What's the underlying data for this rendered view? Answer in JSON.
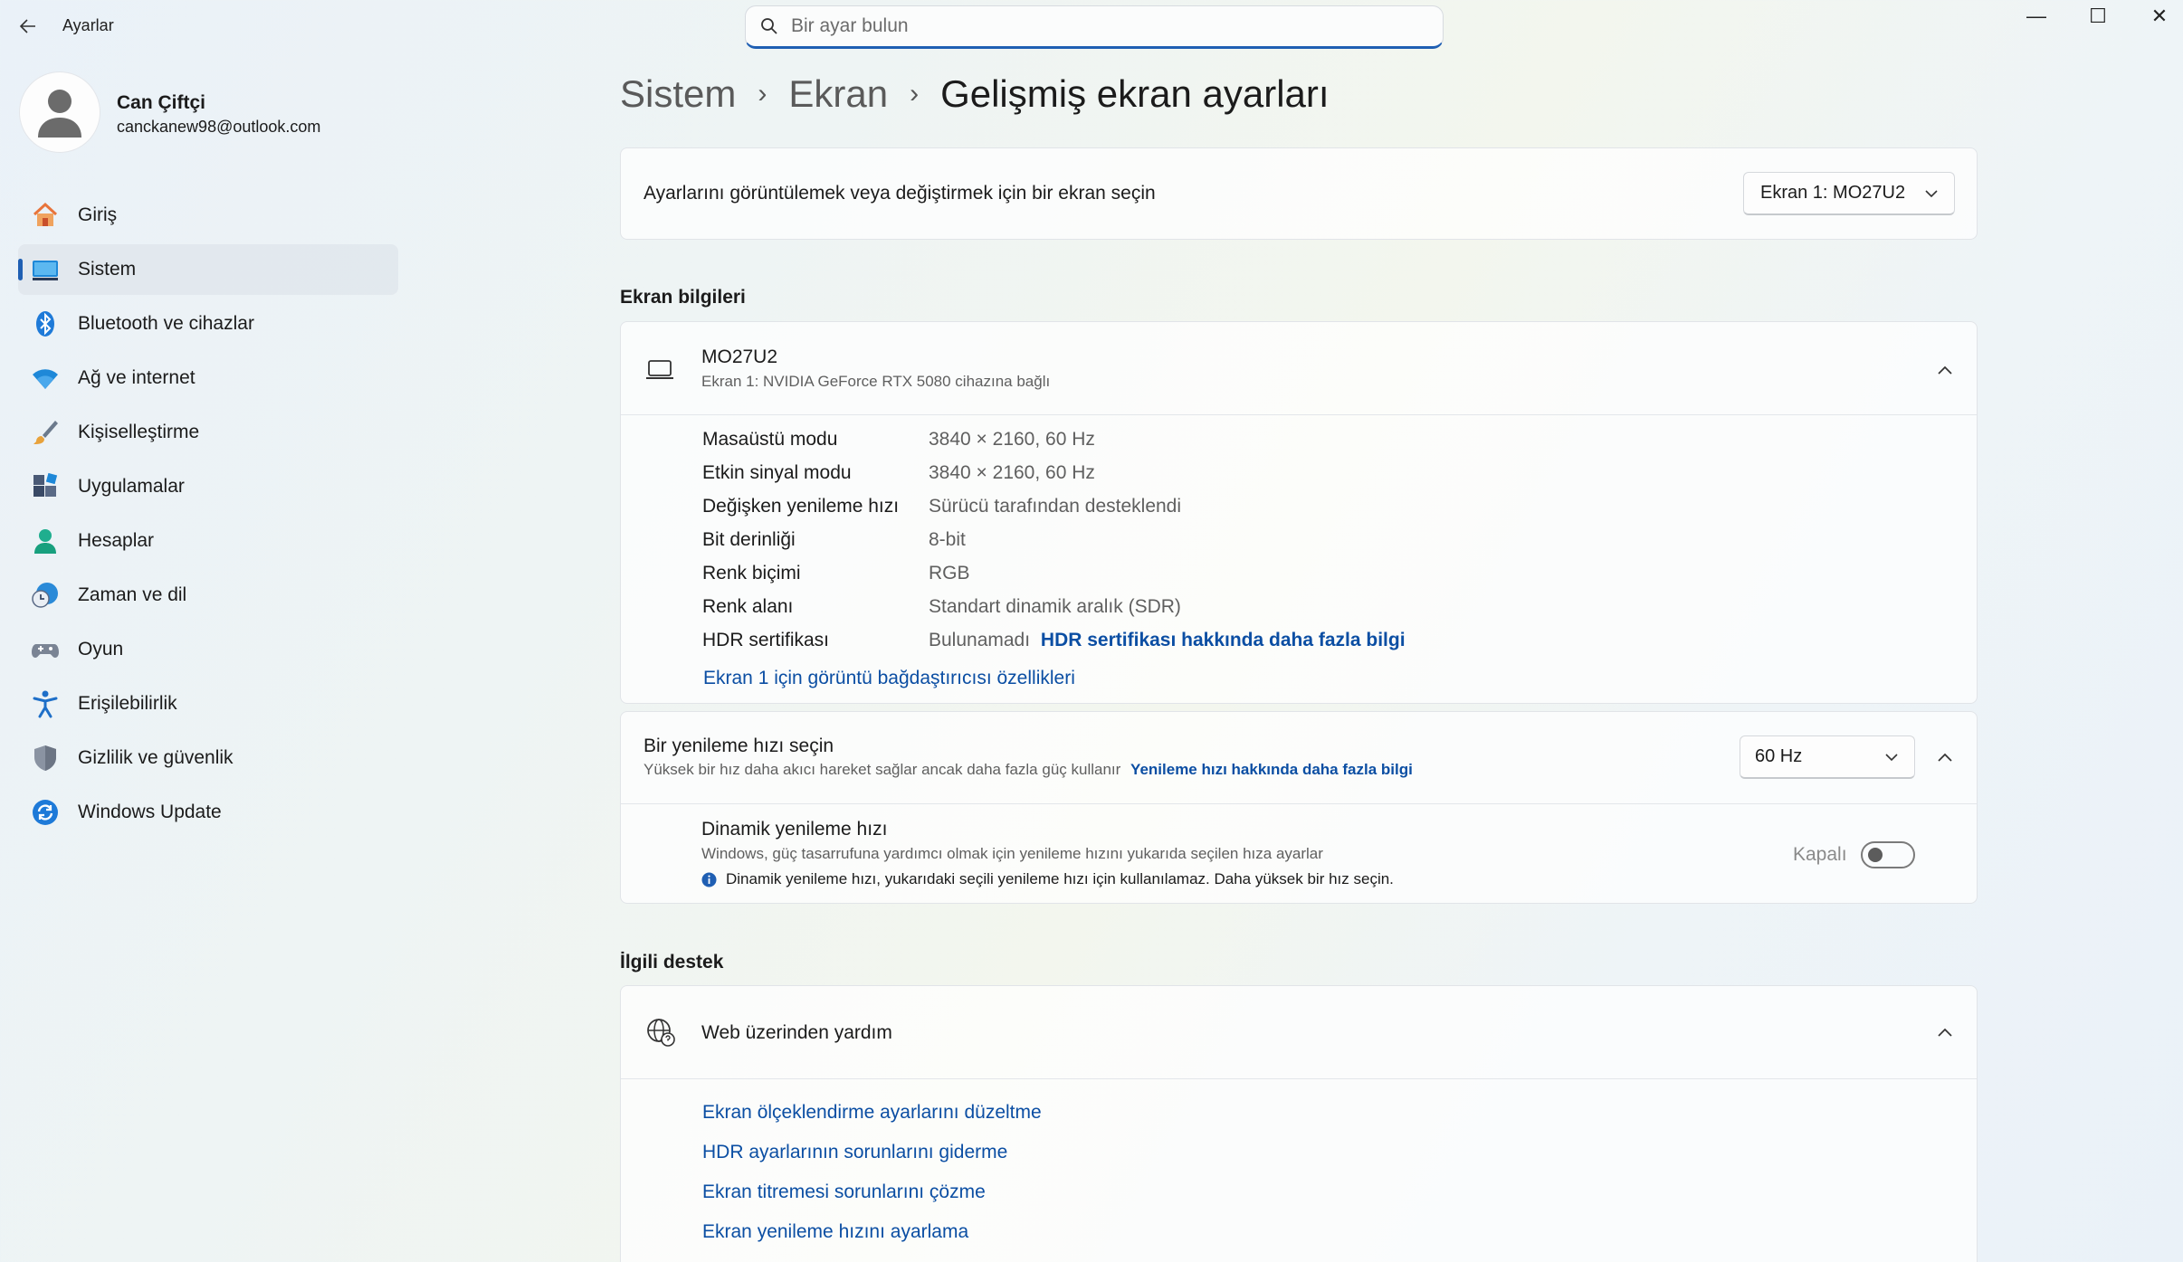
{
  "app": {
    "title": "Ayarlar",
    "back_icon": "back-arrow-icon"
  },
  "search": {
    "placeholder": "Bir ayar bulun"
  },
  "window_controls": {
    "minimize": "—",
    "maximize": "☐",
    "close": "✕"
  },
  "user": {
    "name": "Can Çiftçi",
    "email": "canckanew98@outlook.com"
  },
  "sidebar": {
    "items": [
      {
        "label": "Giriş",
        "icon": "home-icon",
        "active": false
      },
      {
        "label": "Sistem",
        "icon": "system-monitor-icon",
        "active": true
      },
      {
        "label": "Bluetooth ve cihazlar",
        "icon": "bluetooth-icon",
        "active": false
      },
      {
        "label": "Ağ ve internet",
        "icon": "wifi-icon",
        "active": false
      },
      {
        "label": "Kişiselleştirme",
        "icon": "brush-icon",
        "active": false
      },
      {
        "label": "Uygulamalar",
        "icon": "apps-icon",
        "active": false
      },
      {
        "label": "Hesaplar",
        "icon": "account-icon",
        "active": false
      },
      {
        "label": "Zaman ve dil",
        "icon": "time-language-icon",
        "active": false
      },
      {
        "label": "Oyun",
        "icon": "gamepad-icon",
        "active": false
      },
      {
        "label": "Erişilebilirlik",
        "icon": "accessibility-icon",
        "active": false
      },
      {
        "label": "Gizlilik ve güvenlik",
        "icon": "shield-icon",
        "active": false
      },
      {
        "label": "Windows Update",
        "icon": "update-icon",
        "active": false
      }
    ]
  },
  "breadcrumb": {
    "items": [
      "Sistem",
      "Ekran"
    ],
    "current": "Gelişmiş ekran ayarları",
    "separator": "›"
  },
  "display_select": {
    "label": "Ayarlarını görüntülemek veya değiştirmek için bir ekran seçin",
    "value": "Ekran 1: MO27U2"
  },
  "display_info": {
    "heading": "Ekran bilgileri",
    "monitor_name": "MO27U2",
    "monitor_subtitle": "Ekran 1: NVIDIA GeForce RTX 5080 cihazına bağlı",
    "rows": [
      {
        "label": "Masaüstü modu",
        "value": "3840 × 2160, 60 Hz"
      },
      {
        "label": "Etkin sinyal modu",
        "value": "3840 × 2160, 60 Hz"
      },
      {
        "label": "Değişken yenileme hızı",
        "value": "Sürücü tarafından desteklendi"
      },
      {
        "label": "Bit derinliği",
        "value": "8-bit"
      },
      {
        "label": "Renk biçimi",
        "value": "RGB"
      },
      {
        "label": "Renk alanı",
        "value": "Standart dinamik aralık (SDR)"
      }
    ],
    "hdr_label": "HDR sertifikası",
    "hdr_value": "Bulunamadı",
    "hdr_link": "HDR sertifikası hakkında daha fazla bilgi",
    "adapter_link": "Ekran 1 için görüntü bağdaştırıcısı özellikleri"
  },
  "refresh": {
    "title": "Bir yenileme hızı seçin",
    "subtitle": "Yüksek bir hız daha akıcı hareket sağlar ancak daha fazla güç kullanır",
    "link": "Yenileme hızı hakkında daha fazla bilgi",
    "value": "60 Hz",
    "dynamic_title": "Dinamik yenileme hızı",
    "dynamic_subtitle": "Windows, güç tasarrufuna yardımcı olmak için yenileme hızını yukarıda seçilen hıza ayarlar",
    "dynamic_note": "Dinamik yenileme hızı, yukarıdaki seçili yenileme hızı için kullanılamaz. Daha yüksek bir hız seçin.",
    "toggle_label": "Kapalı",
    "toggle_on": false
  },
  "support": {
    "heading": "İlgili destek",
    "web_help": "Web üzerinden yardım",
    "links": [
      "Ekran ölçeklendirme ayarlarını düzeltme",
      "HDR ayarlarının sorunlarını giderme",
      "Ekran titremesi sorunlarını çözme",
      "Ekran yenileme hızını ayarlama"
    ]
  },
  "colors": {
    "accent": "#1f5fb3",
    "link": "#0b4ea3"
  }
}
